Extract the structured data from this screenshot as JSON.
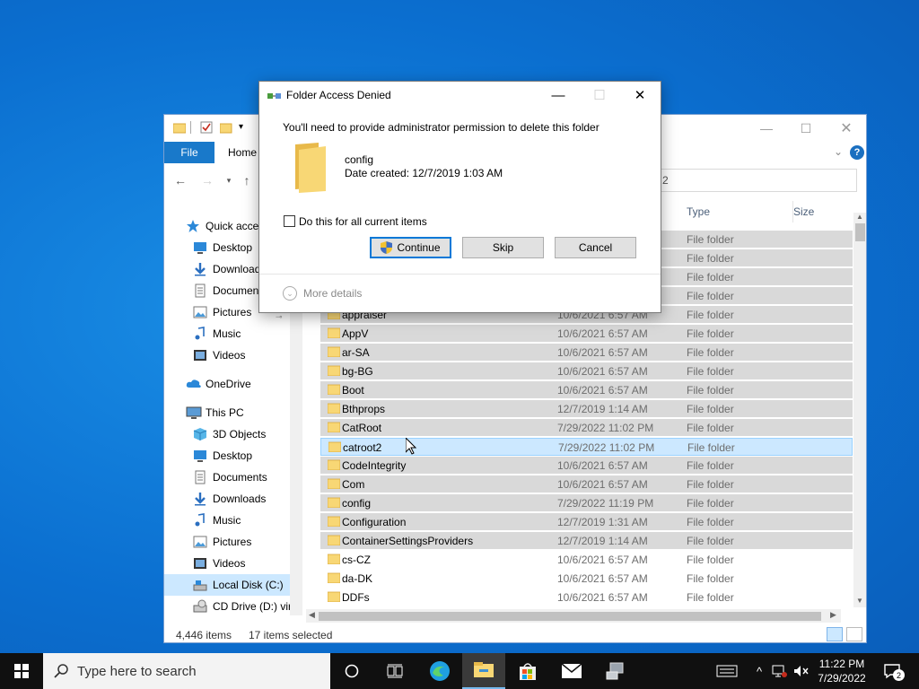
{
  "explorer": {
    "ribbon": {
      "file": "File",
      "home": "Home"
    },
    "address": "2",
    "columns": {
      "type": "Type",
      "size": "Size"
    },
    "nav": [
      {
        "label": "Quick access",
        "icon": "star-icon"
      },
      {
        "label": "Desktop",
        "icon": "desktop-icon"
      },
      {
        "label": "Downloads",
        "icon": "downloads-icon"
      },
      {
        "label": "Documents",
        "icon": "documents-icon"
      },
      {
        "label": "Pictures",
        "icon": "pictures-icon"
      },
      {
        "label": "Music",
        "icon": "music-icon"
      },
      {
        "label": "Videos",
        "icon": "videos-icon"
      },
      {
        "label": "OneDrive",
        "icon": "cloud-icon"
      },
      {
        "label": "This PC",
        "icon": "pc-icon"
      },
      {
        "label": "3D Objects",
        "icon": "cube-icon"
      },
      {
        "label": "Desktop",
        "icon": "desktop-icon"
      },
      {
        "label": "Documents",
        "icon": "documents-icon"
      },
      {
        "label": "Downloads",
        "icon": "downloads-icon"
      },
      {
        "label": "Music",
        "icon": "music-icon"
      },
      {
        "label": "Pictures",
        "icon": "pictures-icon"
      },
      {
        "label": "Videos",
        "icon": "videos-icon"
      },
      {
        "label": "Local Disk (C:)",
        "icon": "drive-icon"
      },
      {
        "label": "CD Drive (D:) virt",
        "icon": "cd-icon"
      }
    ],
    "rows": [
      {
        "name": "",
        "date": "",
        "type": "File folder",
        "state": "sel"
      },
      {
        "name": "",
        "date": "",
        "type": "File folder",
        "state": "sel"
      },
      {
        "name": "",
        "date": "",
        "type": "File folder",
        "state": "sel"
      },
      {
        "name": "",
        "date": "",
        "type": "File folder",
        "state": "sel"
      },
      {
        "name": "appraiser",
        "date": "10/6/2021 6:57 AM",
        "type": "File folder",
        "state": "sel"
      },
      {
        "name": "AppV",
        "date": "10/6/2021 6:57 AM",
        "type": "File folder",
        "state": "sel"
      },
      {
        "name": "ar-SA",
        "date": "10/6/2021 6:57 AM",
        "type": "File folder",
        "state": "sel"
      },
      {
        "name": "bg-BG",
        "date": "10/6/2021 6:57 AM",
        "type": "File folder",
        "state": "sel"
      },
      {
        "name": "Boot",
        "date": "10/6/2021 6:57 AM",
        "type": "File folder",
        "state": "sel"
      },
      {
        "name": "Bthprops",
        "date": "12/7/2019 1:14 AM",
        "type": "File folder",
        "state": "sel"
      },
      {
        "name": "CatRoot",
        "date": "7/29/2022 11:02 PM",
        "type": "File folder",
        "state": "sel"
      },
      {
        "name": "catroot2",
        "date": "7/29/2022 11:02 PM",
        "type": "File folder",
        "state": "focus"
      },
      {
        "name": "CodeIntegrity",
        "date": "10/6/2021 6:57 AM",
        "type": "File folder",
        "state": "sel"
      },
      {
        "name": "Com",
        "date": "10/6/2021 6:57 AM",
        "type": "File folder",
        "state": "sel"
      },
      {
        "name": "config",
        "date": "7/29/2022 11:19 PM",
        "type": "File folder",
        "state": "sel"
      },
      {
        "name": "Configuration",
        "date": "12/7/2019 1:31 AM",
        "type": "File folder",
        "state": "sel"
      },
      {
        "name": "ContainerSettingsProviders",
        "date": "12/7/2019 1:14 AM",
        "type": "File folder",
        "state": "sel"
      },
      {
        "name": "cs-CZ",
        "date": "10/6/2021 6:57 AM",
        "type": "File folder",
        "state": ""
      },
      {
        "name": "da-DK",
        "date": "10/6/2021 6:57 AM",
        "type": "File folder",
        "state": ""
      },
      {
        "name": "DDFs",
        "date": "10/6/2021 6:57 AM",
        "type": "File folder",
        "state": ""
      }
    ],
    "status": {
      "items": "4,446 items",
      "selected": "17 items selected"
    }
  },
  "dialog": {
    "title": "Folder Access Denied",
    "message": "You'll need to provide administrator permission to delete this folder",
    "folder_name": "config",
    "date_created": "Date created: 12/7/2019 1:03 AM",
    "checkbox_label": "Do this for all current items",
    "buttons": {
      "continue": "Continue",
      "skip": "Skip",
      "cancel": "Cancel"
    },
    "more_details": "More details"
  },
  "taskbar": {
    "search_placeholder": "Type here to search",
    "time": "11:22 PM",
    "date": "7/29/2022",
    "notification_count": "2"
  },
  "colors": {
    "accent": "#0078d7",
    "selection": "#d9d9d9",
    "focus_row": "#cce8ff",
    "folder": "#f8d775"
  }
}
